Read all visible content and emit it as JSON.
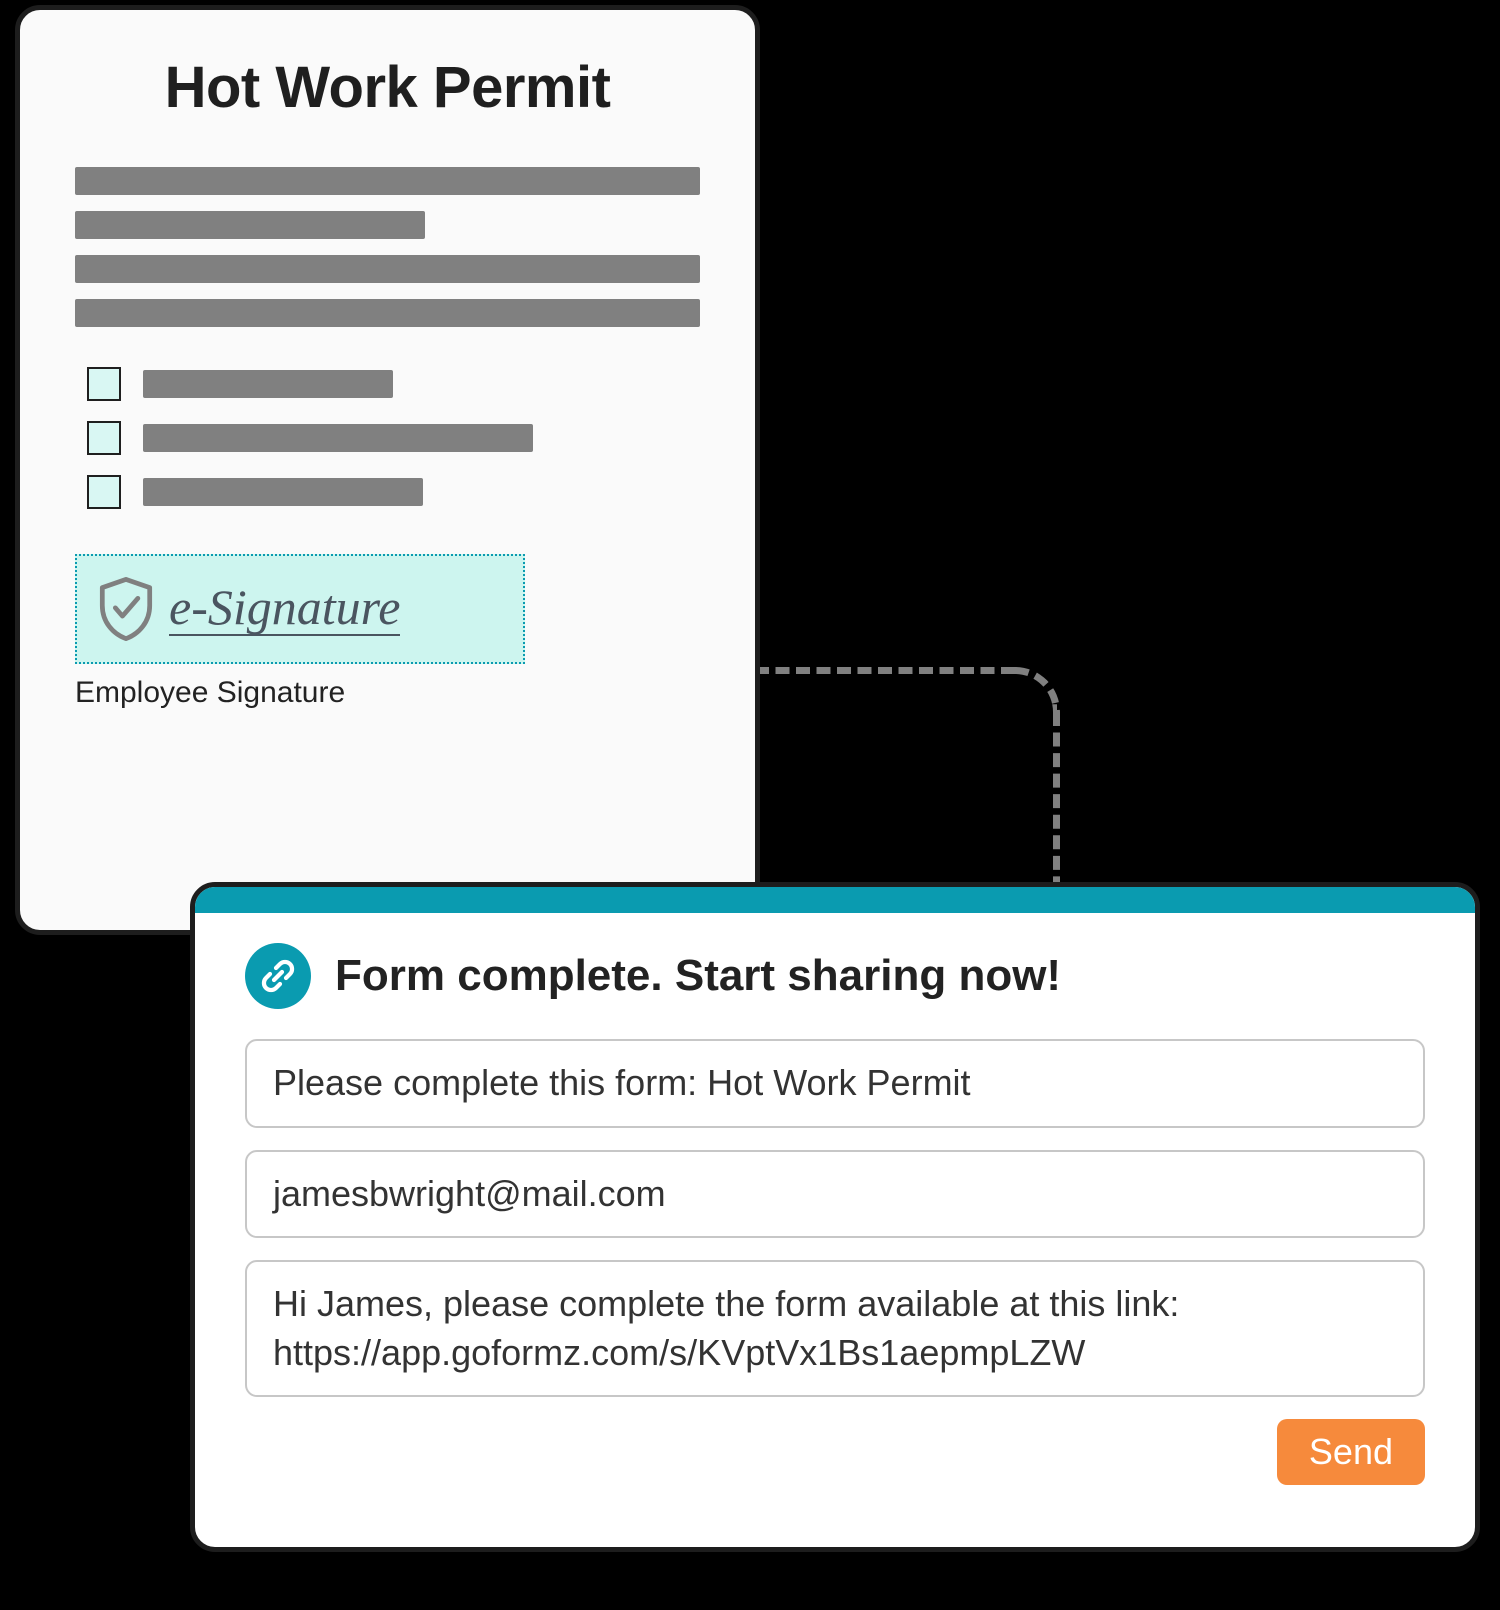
{
  "form": {
    "title": "Hot Work Permit",
    "signature_text": "e-Signature",
    "signature_label": "Employee Signature"
  },
  "share": {
    "header": "Form complete. Start sharing now!",
    "subject": "Please complete this form: Hot Work Permit",
    "email": "jamesbwright@mail.com",
    "message": "Hi James, please complete the form available at this link: https://app.goformz.com/s/KVptVx1Bs1aepmpLZW",
    "send_label": "Send"
  }
}
